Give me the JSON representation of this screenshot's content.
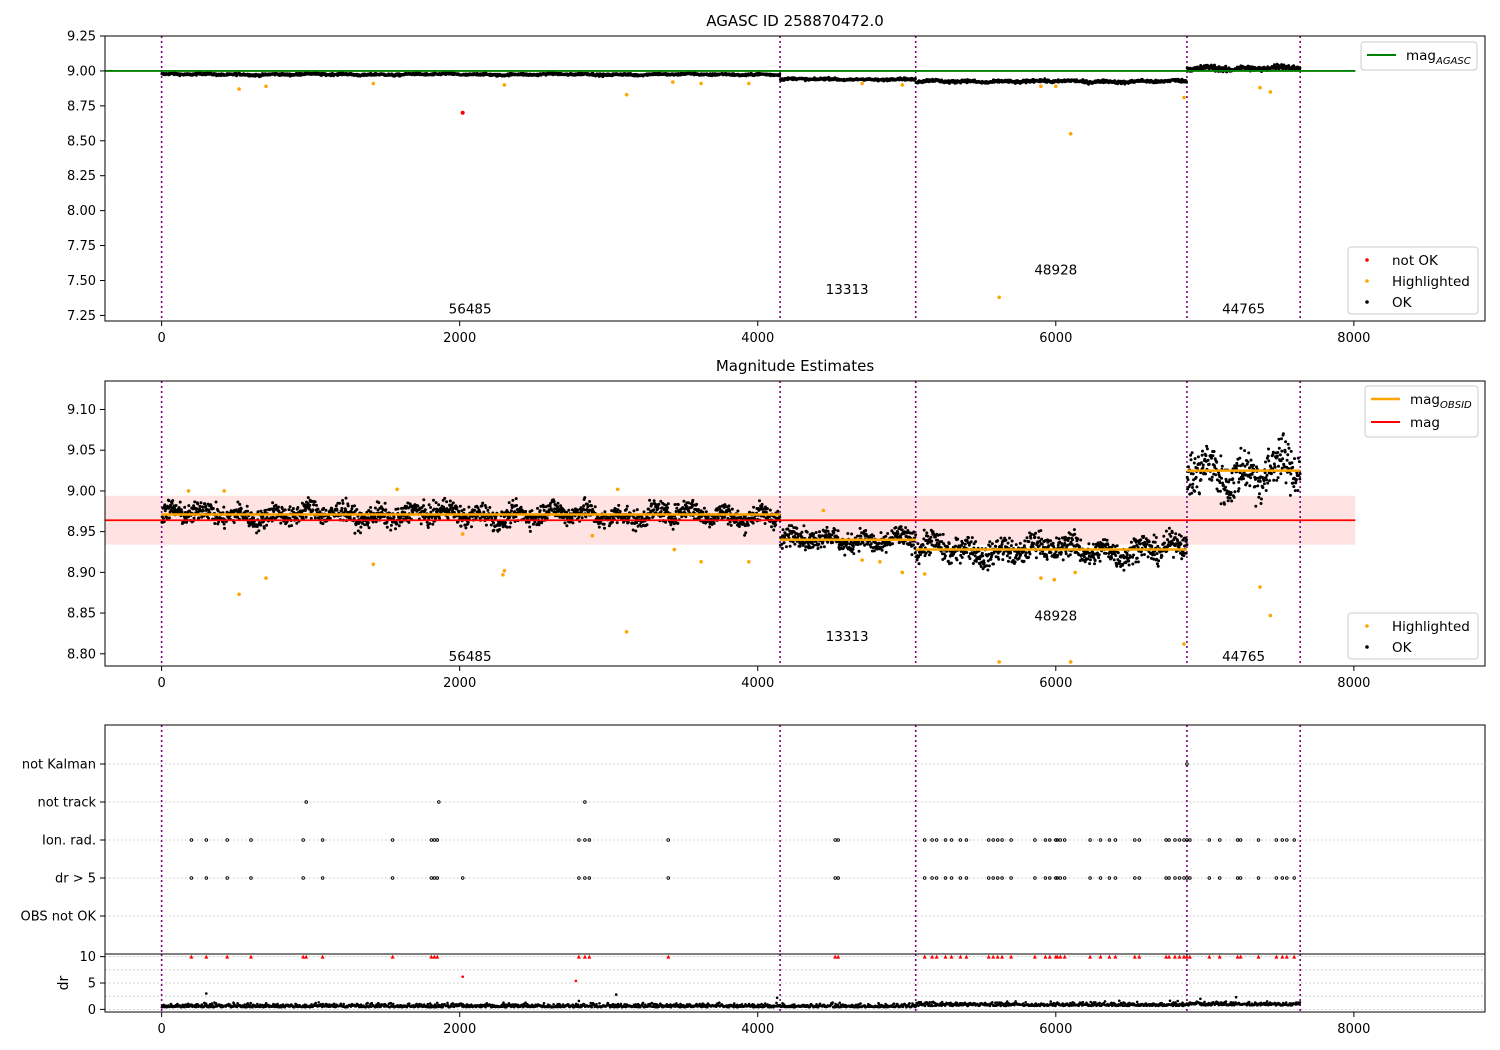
{
  "chart_data": [
    {
      "type": "scatter",
      "title": "AGASC ID 258870472.0",
      "xlim": [
        -380,
        8880
      ],
      "ylim": [
        7.21,
        9.25
      ],
      "xticks": [
        0,
        2000,
        4000,
        6000,
        8000
      ],
      "xtick_labels": [
        "0",
        "2000",
        "4000",
        "6000",
        "8000"
      ],
      "yticks": [
        7.25,
        7.5,
        7.75,
        8.0,
        8.25,
        8.5,
        8.75,
        9.0,
        9.25
      ],
      "ytick_labels": [
        "7.25",
        "7.50",
        "7.75",
        "8.00",
        "8.25",
        "8.50",
        "8.75",
        "9.00",
        "9.25"
      ],
      "observation_boundaries": [
        0,
        4150,
        5060,
        6880,
        7640
      ],
      "observations": [
        {
          "obsid": "56485",
          "x0": 0,
          "x1": 4150,
          "mean": 8.975,
          "noise": 0.006,
          "label_x": 2070,
          "label_y": 7.3
        },
        {
          "obsid": "13313",
          "x0": 4150,
          "x1": 5060,
          "mean": 8.94,
          "noise": 0.006,
          "label_x": 4600,
          "label_y": 7.44
        },
        {
          "obsid": "48928",
          "x0": 5060,
          "x1": 6880,
          "mean": 8.925,
          "noise": 0.008,
          "label_x": 6000,
          "label_y": 7.58
        },
        {
          "obsid": "44765",
          "x0": 6880,
          "x1": 7640,
          "mean": 9.02,
          "noise": 0.014,
          "label_x": 7260,
          "label_y": 7.3
        }
      ],
      "agasc_mag": 9.0,
      "agasc_line_x": [
        -380,
        8010
      ],
      "highlighted": [
        [
          520,
          8.87
        ],
        [
          700,
          8.89
        ],
        [
          1420,
          8.91
        ],
        [
          2300,
          8.9
        ],
        [
          3120,
          8.83
        ],
        [
          3430,
          8.92
        ],
        [
          3620,
          8.91
        ],
        [
          3940,
          8.91
        ],
        [
          4700,
          8.91
        ],
        [
          4970,
          8.9
        ],
        [
          5620,
          7.38
        ],
        [
          5900,
          8.89
        ],
        [
          6000,
          8.89
        ],
        [
          6100,
          8.55
        ],
        [
          6860,
          8.81
        ],
        [
          7370,
          8.88
        ],
        [
          7440,
          8.85
        ]
      ],
      "not_ok": [
        [
          2020,
          8.7
        ]
      ],
      "legend_line": {
        "label": "mag",
        "sub": "AGASC",
        "color": "#008000"
      },
      "legend_points": [
        {
          "label": "not OK",
          "color": "#ff0000"
        },
        {
          "label": "Highlighted",
          "color": "#ffa500"
        },
        {
          "label": "OK",
          "color": "#000000"
        }
      ]
    },
    {
      "type": "scatter",
      "title": "Magnitude Estimates",
      "xlim": [
        -380,
        8880
      ],
      "ylim": [
        8.785,
        9.135
      ],
      "xticks": [
        0,
        2000,
        4000,
        6000,
        8000
      ],
      "xtick_labels": [
        "0",
        "2000",
        "4000",
        "6000",
        "8000"
      ],
      "yticks": [
        8.8,
        8.85,
        8.9,
        8.95,
        9.0,
        9.05,
        9.1
      ],
      "ytick_labels": [
        "8.80",
        "8.85",
        "8.90",
        "8.95",
        "9.00",
        "9.05",
        "9.10"
      ],
      "observation_boundaries": [
        0,
        4150,
        5060,
        6880,
        7640
      ],
      "observations": [
        {
          "obsid": "56485",
          "x0": 0,
          "x1": 4150,
          "mean": 8.971,
          "noise": 0.009,
          "label_x": 2070,
          "label_y": 8.797
        },
        {
          "obsid": "13313",
          "x0": 4150,
          "x1": 5060,
          "mean": 8.94,
          "noise": 0.009,
          "label_x": 4600,
          "label_y": 8.822
        },
        {
          "obsid": "48928",
          "x0": 5060,
          "x1": 6880,
          "mean": 8.928,
          "noise": 0.011,
          "label_x": 6000,
          "label_y": 8.847
        },
        {
          "obsid": "44765",
          "x0": 6880,
          "x1": 7640,
          "mean": 9.025,
          "noise": 0.02,
          "label_x": 7260,
          "label_y": 8.797
        }
      ],
      "mag_mean": 8.964,
      "mag_band": [
        8.934,
        8.994
      ],
      "mag_line_x": [
        -380,
        8010
      ],
      "obsid_mags": [
        {
          "x0": 0,
          "x1": 4150,
          "mag": 8.971
        },
        {
          "x0": 4150,
          "x1": 5060,
          "mag": 8.94
        },
        {
          "x0": 5060,
          "x1": 6880,
          "mag": 8.928
        },
        {
          "x0": 6880,
          "x1": 7640,
          "mag": 9.025
        }
      ],
      "highlighted": [
        [
          180,
          9.0
        ],
        [
          420,
          9.0
        ],
        [
          520,
          8.873
        ],
        [
          700,
          8.893
        ],
        [
          1420,
          8.91
        ],
        [
          1580,
          9.002
        ],
        [
          2020,
          8.947
        ],
        [
          2290,
          8.897
        ],
        [
          2300,
          8.902
        ],
        [
          2890,
          8.945
        ],
        [
          3120,
          8.827
        ],
        [
          3060,
          9.002
        ],
        [
          3440,
          8.928
        ],
        [
          3620,
          8.913
        ],
        [
          3940,
          8.913
        ],
        [
          4440,
          8.976
        ],
        [
          4700,
          8.915
        ],
        [
          4820,
          8.913
        ],
        [
          4970,
          8.9
        ],
        [
          5120,
          8.898
        ],
        [
          5620,
          8.79
        ],
        [
          5900,
          8.893
        ],
        [
          5990,
          8.891
        ],
        [
          6100,
          8.79
        ],
        [
          6130,
          8.9
        ],
        [
          6860,
          8.812
        ],
        [
          7370,
          8.882
        ],
        [
          7440,
          8.847
        ]
      ],
      "legend_lines": [
        {
          "label": "mag",
          "sub": "OBSID",
          "color": "#ffa500"
        },
        {
          "label": "mag",
          "sub": "",
          "color": "#ff0000"
        }
      ],
      "legend_points": [
        {
          "label": "Highlighted",
          "color": "#ffa500"
        },
        {
          "label": "OK",
          "color": "#000000"
        }
      ]
    },
    {
      "type": "scatter",
      "title": "",
      "xlim": [
        -380,
        8880
      ],
      "flag_categories": [
        "not Kalman",
        "not track",
        "Ion. rad.",
        "dr > 5",
        "OBS not OK"
      ],
      "flags": {
        "not Kalman": [
          6880
        ],
        "not track": [
          970,
          1860,
          2840
        ],
        "Ion. rad.": [
          200,
          300,
          440,
          600,
          950,
          1080,
          1550,
          1810,
          1830,
          1850,
          2800,
          2840,
          2870,
          3400,
          4520,
          4540,
          5120,
          5170,
          5200,
          5260,
          5300,
          5360,
          5400,
          5550,
          5580,
          5610,
          5640,
          5700,
          5860,
          5930,
          5960,
          6000,
          6010,
          6030,
          6060,
          6230,
          6300,
          6360,
          6400,
          6530,
          6560,
          6740,
          6760,
          6800,
          6830,
          6860,
          6880,
          6900,
          7030,
          7100,
          7220,
          7240,
          7360,
          7480,
          7520,
          7550,
          7600
        ],
        "dr > 5": [
          200,
          300,
          440,
          600,
          950,
          1080,
          1550,
          1810,
          1830,
          1850,
          2020,
          2800,
          2840,
          2870,
          3400,
          4520,
          4540,
          5120,
          5170,
          5200,
          5260,
          5300,
          5360,
          5400,
          5550,
          5580,
          5610,
          5640,
          5700,
          5860,
          5930,
          5960,
          6000,
          6010,
          6030,
          6060,
          6230,
          6300,
          6360,
          6400,
          6530,
          6560,
          6740,
          6760,
          6800,
          6830,
          6860,
          6880,
          6900,
          7030,
          7100,
          7220,
          7240,
          7360,
          7480,
          7520,
          7550,
          7600
        ],
        "OBS not OK": []
      },
      "observation_boundaries": [
        0,
        4150,
        5060,
        6880,
        7640
      ]
    },
    {
      "type": "scatter",
      "title": "",
      "xlim": [
        -380,
        8880
      ],
      "ylim": [
        -0.5,
        10.5
      ],
      "xticks": [
        0,
        2000,
        4000,
        6000,
        8000
      ],
      "xtick_labels": [
        "0",
        "2000",
        "4000",
        "6000",
        "8000"
      ],
      "yticks": [
        0,
        5,
        10
      ],
      "ytick_labels": [
        "0",
        "5",
        "10"
      ],
      "ylabel": "dr",
      "clip_value": 10,
      "clipped_x": [
        200,
        300,
        440,
        600,
        950,
        970,
        1080,
        1550,
        1810,
        1830,
        1850,
        2800,
        2840,
        2870,
        3400,
        4520,
        4540,
        5120,
        5170,
        5200,
        5260,
        5300,
        5360,
        5400,
        5550,
        5580,
        5610,
        5640,
        5700,
        5860,
        5930,
        5960,
        6000,
        6010,
        6030,
        6060,
        6230,
        6300,
        6360,
        6400,
        6530,
        6560,
        6740,
        6760,
        6800,
        6830,
        6860,
        6880,
        6900,
        7030,
        7100,
        7220,
        7240,
        7360,
        7480,
        7520,
        7550,
        7600
      ],
      "outliers": [
        [
          300,
          3.0
        ],
        [
          2020,
          6.2
        ],
        [
          2780,
          5.4
        ],
        [
          2800,
          1.6
        ],
        [
          3050,
          2.8
        ],
        [
          4130,
          2.2
        ],
        [
          6970,
          2.0
        ],
        [
          7210,
          2.3
        ],
        [
          2880,
          1.2
        ]
      ],
      "observation_boundaries": [
        0,
        4150,
        5060,
        6880,
        7640
      ]
    }
  ]
}
